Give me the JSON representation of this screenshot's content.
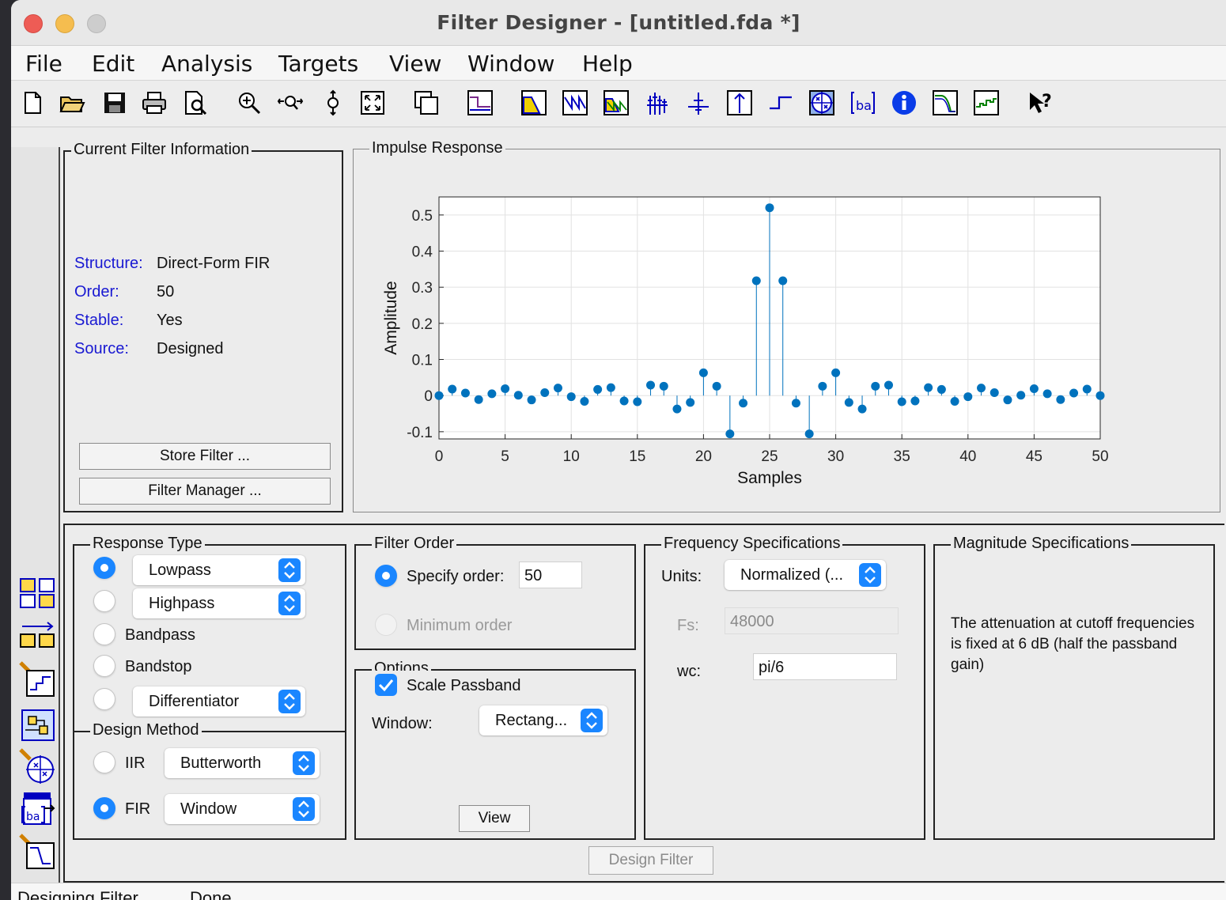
{
  "window": {
    "title": "Filter Designer -  [untitled.fda *]"
  },
  "menu": [
    "File",
    "Edit",
    "Analysis",
    "Targets",
    "View",
    "Window",
    "Help"
  ],
  "toolbar_icons": [
    "new-file-icon",
    "open-folder-icon",
    "save-icon",
    "print-icon",
    "print-preview-icon",
    "zoom-in-icon",
    "zoom-x-icon",
    "zoom-y-icon",
    "full-view-icon",
    "new-figure-icon",
    "filter-specifications-icon",
    "magnitude-response-icon",
    "phase-response-icon",
    "magnitude-phase-icon",
    "group-delay-icon",
    "phase-delay-icon",
    "impulse-response-icon",
    "step-response-icon",
    "pole-zero-icon",
    "filter-coefficients-icon",
    "filter-information-icon",
    "magnitude-estimate-icon",
    "round-off-noise-icon",
    "whats-this-help-icon"
  ],
  "sidebar_icons": [
    "transform-filter-icon",
    "create-multirate-icon",
    "quantize-icon",
    "realize-model-icon",
    "pole-zero-editor-icon",
    "import-filter-icon",
    "design-filter-icon"
  ],
  "info_panel": {
    "title": "Current Filter Information",
    "rows": [
      {
        "label": "Structure:",
        "value": "Direct-Form FIR"
      },
      {
        "label": "Order:",
        "value": "50"
      },
      {
        "label": "Stable:",
        "value": "Yes"
      },
      {
        "label": "Source:",
        "value": "Designed"
      }
    ],
    "store_label": "Store Filter ...",
    "manager_label": "Filter Manager ..."
  },
  "plot_panel": {
    "title": "Impulse Response"
  },
  "chart_data": {
    "type": "stem",
    "title": "",
    "xlabel": "Samples",
    "ylabel": "Amplitude",
    "xlim": [
      0,
      50
    ],
    "ylim": [
      -0.12,
      0.55
    ],
    "xticks": [
      "0",
      "5",
      "10",
      "15",
      "20",
      "25",
      "30",
      "35",
      "40",
      "45",
      "50"
    ],
    "yticks": [
      "0.5",
      "0.4",
      "0.3",
      "0.2",
      "0.1",
      "0",
      "-0.1"
    ],
    "grid": true,
    "color": "#0072bd",
    "x": [
      0,
      1,
      2,
      3,
      4,
      5,
      6,
      7,
      8,
      9,
      10,
      11,
      12,
      13,
      14,
      15,
      16,
      17,
      18,
      19,
      20,
      21,
      22,
      23,
      24,
      25,
      26,
      27,
      28,
      29,
      30,
      31,
      32,
      33,
      34,
      35,
      36,
      37,
      38,
      39,
      40,
      41,
      42,
      43,
      44,
      45,
      46,
      47,
      48,
      49,
      50
    ],
    "y": [
      0,
      0.018,
      0.007,
      -0.011,
      0.005,
      0.019,
      0.001,
      -0.012,
      0.008,
      0.021,
      -0.003,
      -0.016,
      0.017,
      0.022,
      -0.015,
      -0.017,
      0.029,
      0.026,
      -0.037,
      -0.019,
      0.063,
      0.026,
      -0.106,
      -0.021,
      0.318,
      0.52,
      0.318,
      -0.021,
      -0.106,
      0.026,
      0.063,
      -0.019,
      -0.037,
      0.026,
      0.029,
      -0.017,
      -0.015,
      0.022,
      0.017,
      -0.016,
      -0.003,
      0.021,
      0.008,
      -0.012,
      0.001,
      0.019,
      0.005,
      -0.011,
      0.007,
      0.018,
      0
    ]
  },
  "response_type": {
    "title": "Response Type",
    "lowpass": "Lowpass",
    "highpass": "Highpass",
    "bandpass": "Bandpass",
    "bandstop": "Bandstop",
    "differentiator": "Differentiator"
  },
  "design_method": {
    "title": "Design Method",
    "iir_label": "IIR",
    "iir_value": "Butterworth",
    "fir_label": "FIR",
    "fir_value": "Window"
  },
  "filter_order": {
    "title": "Filter Order",
    "specify_label": "Specify order:",
    "specify_value": "50",
    "minimum_label": "Minimum order"
  },
  "options": {
    "title": "Options",
    "scale_label": "Scale Passband",
    "window_label": "Window:",
    "window_value": "Rectang...",
    "view_label": "View"
  },
  "freq_specs": {
    "title": "Frequency Specifications",
    "units_label": "Units:",
    "units_value": "Normalized (...",
    "fs_label": "Fs:",
    "fs_value": "48000",
    "wc_label": "wc:",
    "wc_value": "pi/6"
  },
  "mag_specs": {
    "title": "Magnitude Specifications",
    "text": "The attenuation at cutoff frequencies is fixed at 6 dB (half the passband gain)"
  },
  "design_button": "Design Filter",
  "status": {
    "left": "Designing Filter ...",
    "right": "Done"
  }
}
